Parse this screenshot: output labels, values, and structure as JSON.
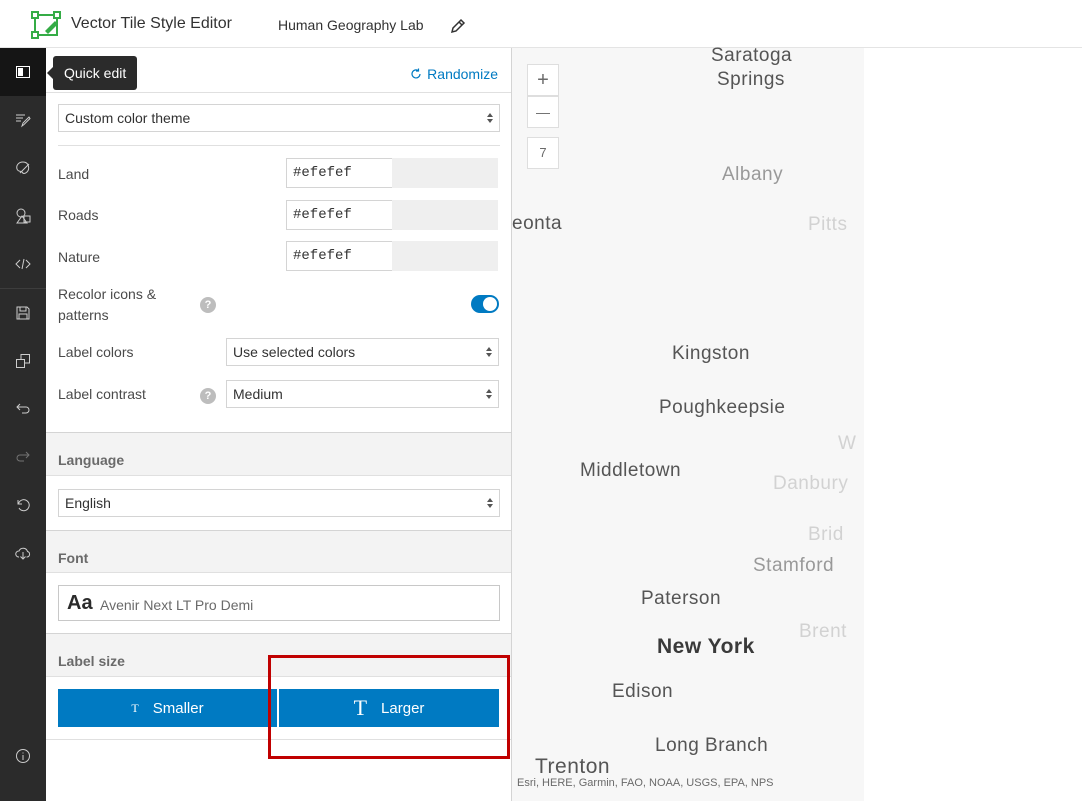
{
  "header": {
    "app_title": "Vector Tile Style Editor",
    "project_name": "Human Geography Lab"
  },
  "rail": {
    "tooltip": "Quick edit",
    "items": [
      {
        "icon": "quick-edit-icon",
        "active": true
      },
      {
        "icon": "edit-layers-icon"
      },
      {
        "icon": "edit-colors-icon"
      },
      {
        "icon": "shapes-icon"
      },
      {
        "icon": "code-icon"
      },
      {
        "icon": "save-icon"
      },
      {
        "icon": "duplicate-icon"
      },
      {
        "icon": "undo-icon"
      },
      {
        "icon": "redo-icon",
        "disabled": true
      },
      {
        "icon": "reset-icon"
      },
      {
        "icon": "download-icon"
      },
      {
        "icon": "info-icon"
      }
    ]
  },
  "panel": {
    "randomize": "Randomize",
    "theme_select": "Custom color theme",
    "colors": [
      {
        "label": "Land",
        "value": "#efefef"
      },
      {
        "label": "Roads",
        "value": "#efefef"
      },
      {
        "label": "Nature",
        "value": "#efefef"
      }
    ],
    "recolor_label_line1": "Recolor icons &",
    "recolor_label_line2": "patterns",
    "recolor_enabled": true,
    "label_colors_label": "Label colors",
    "label_colors_value": "Use selected colors",
    "label_contrast_label": "Label contrast",
    "label_contrast_value": "Medium",
    "language_title": "Language",
    "language_value": "English",
    "font_title": "Font",
    "font_sample": "Aa",
    "font_name": "Avenir Next LT Pro Demi",
    "label_size_title": "Label size",
    "smaller_label": "Smaller",
    "larger_label": "Larger",
    "size_small_glyph": "T",
    "size_large_glyph": "T",
    "help_glyph": "?"
  },
  "map": {
    "zoom_in": "+",
    "zoom_out": "—",
    "zoom_level": "7",
    "places": {
      "saratoga1": "Saratoga",
      "saratoga2": "Springs",
      "albany": "Albany",
      "oneonta": "eonta",
      "pittsfield": "Pitts",
      "kingston": "Kingston",
      "poughkeepsie": "Poughkeepsie",
      "middletown": "Middletown",
      "danbury": "Danbury",
      "bridgeport": "Brid",
      "waterbury": "W",
      "stamford": "Stamford",
      "paterson": "Paterson",
      "brentwood": "Brent",
      "newyork": "New York",
      "edison": "Edison",
      "longbranch": "Long Branch",
      "trenton": "Trenton"
    },
    "attribution": "Esri, HERE, Garmin, FAO, NOAA, USGS, EPA, NPS"
  },
  "colors": {
    "accent": "#007ac2",
    "rail": "#2b2b2b",
    "highlight": "#c00000",
    "logo": "#35ac46"
  }
}
